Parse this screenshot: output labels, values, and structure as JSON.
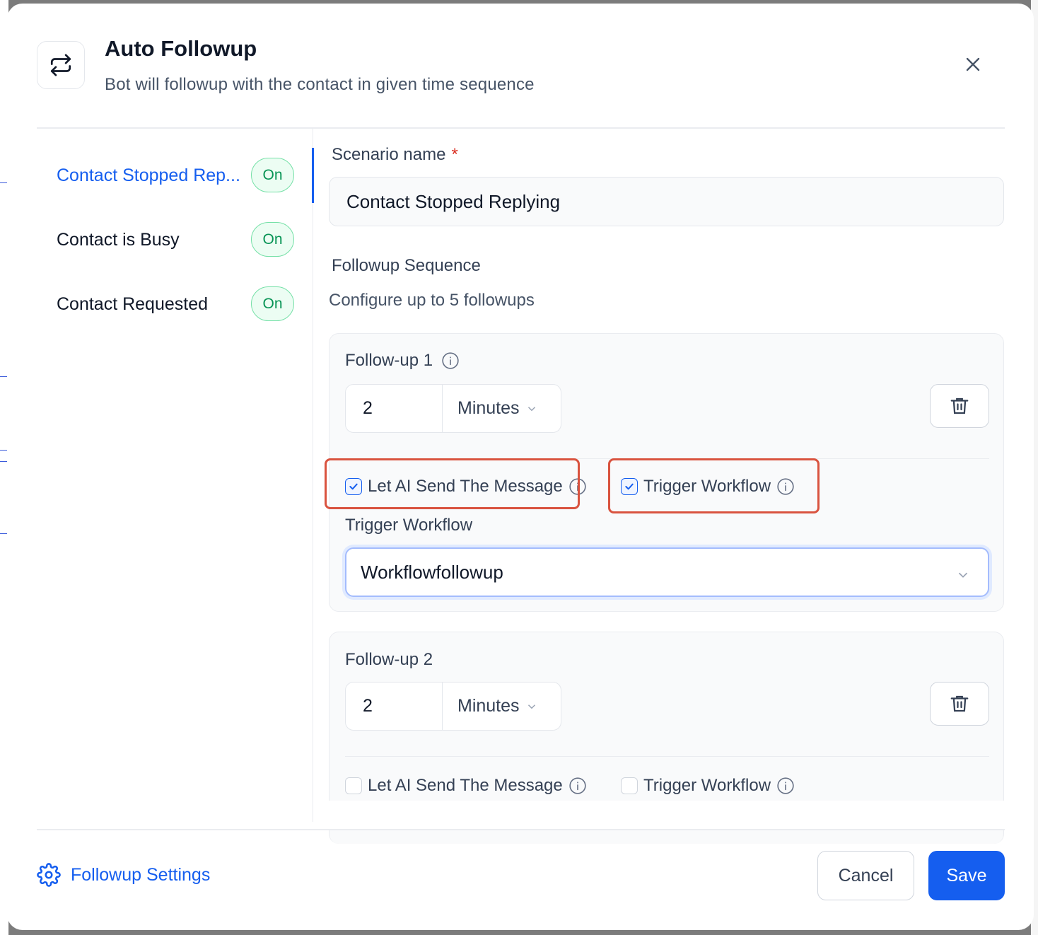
{
  "modal": {
    "title": "Auto Followup",
    "subtitle": "Bot will followup with the contact in given time sequence"
  },
  "scenarios": [
    {
      "label": "Contact Stopped Rep...",
      "status": "On",
      "active": true
    },
    {
      "label": "Contact is Busy",
      "status": "On",
      "active": false
    },
    {
      "label": "Contact Requested",
      "status": "On",
      "active": false
    }
  ],
  "form": {
    "scenario_name_label": "Scenario name",
    "required_marker": "*",
    "scenario_name_value": "Contact Stopped Replying",
    "sequence_title": "Followup Sequence",
    "sequence_help": "Configure up to 5 followups"
  },
  "followups": [
    {
      "title": "Follow-up 1",
      "value": "2",
      "unit": "Minutes",
      "ai_label": "Let AI Send The Message",
      "ai_checked": true,
      "workflow_label": "Trigger Workflow",
      "workflow_checked": true,
      "workflow_field_label": "Trigger Workflow",
      "workflow_value": "Workflowfollowup"
    },
    {
      "title": "Follow-up 2",
      "value": "2",
      "unit": "Minutes",
      "ai_label": "Let AI Send The Message",
      "ai_checked": false,
      "workflow_label": "Trigger Workflow",
      "workflow_checked": false
    }
  ],
  "footer": {
    "settings_label": "Followup Settings",
    "cancel_label": "Cancel",
    "save_label": "Save"
  },
  "colors": {
    "accent": "#155eef",
    "on_green": "#079455",
    "highlight": "#d9533f"
  }
}
